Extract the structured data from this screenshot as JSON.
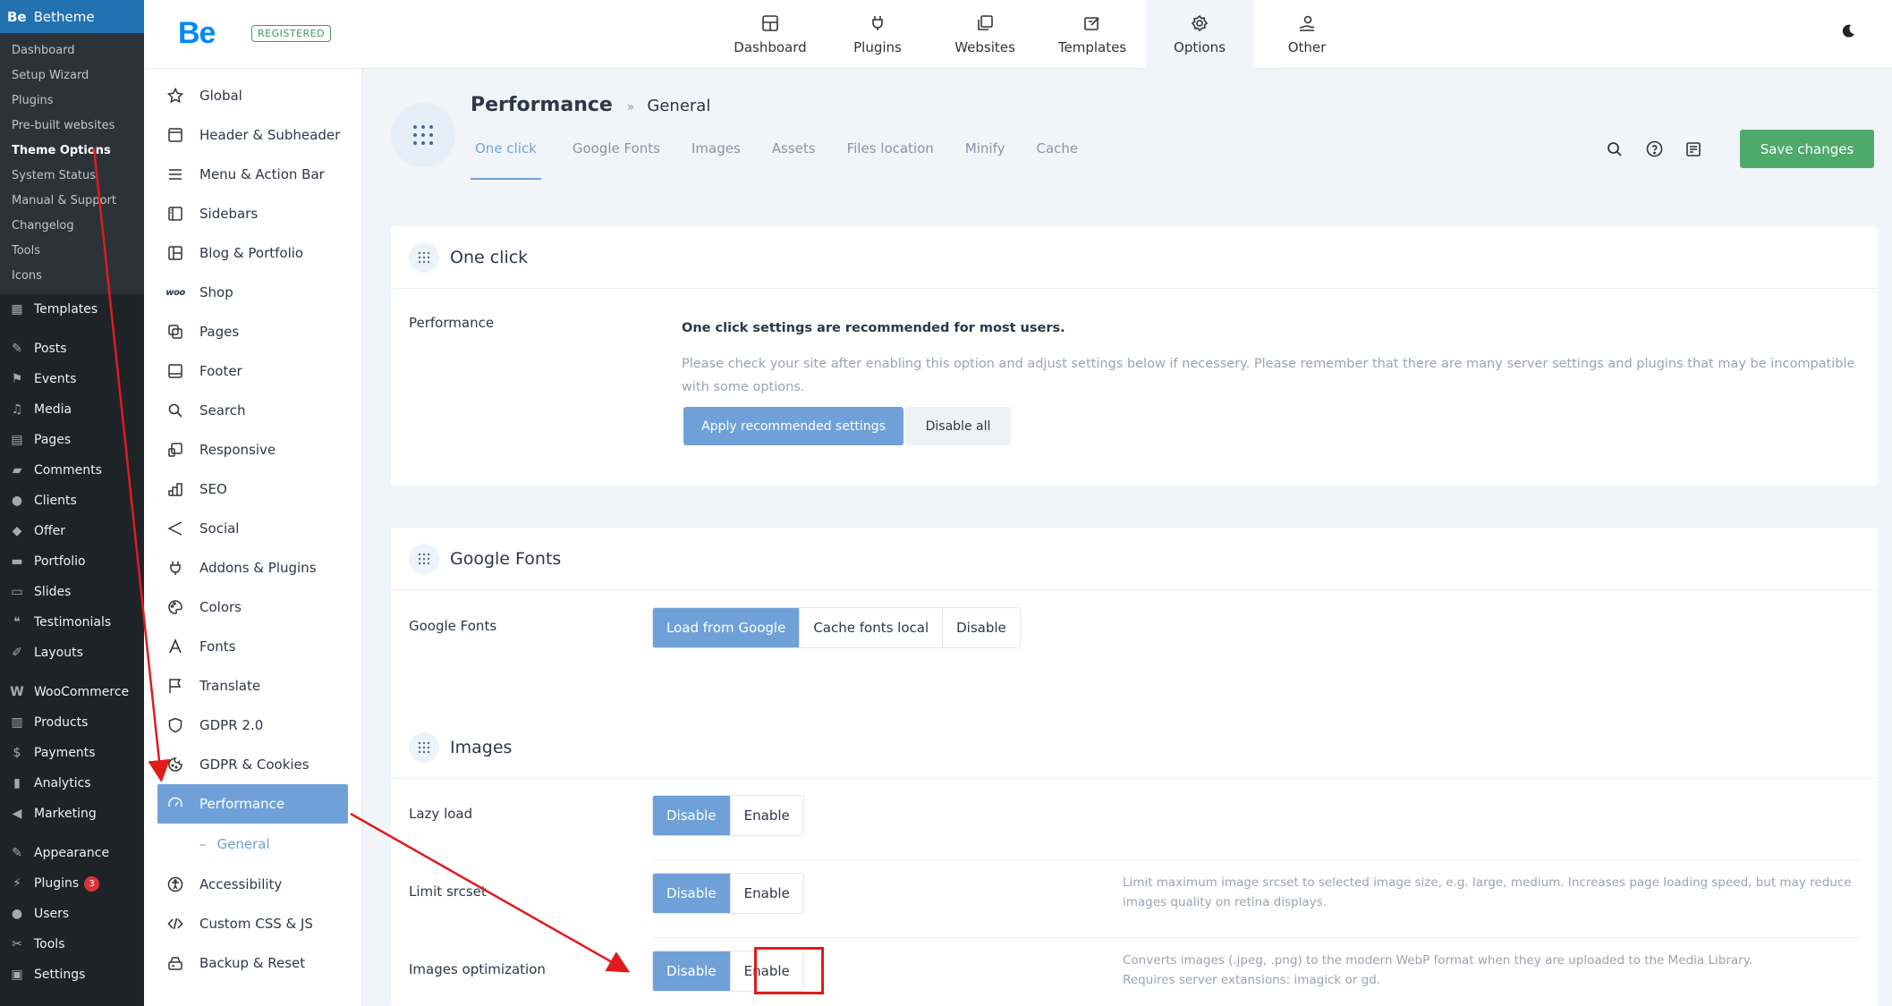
{
  "wp": {
    "brand": "Betheme",
    "brand_mark": "Be",
    "submenu": [
      "Dashboard",
      "Setup Wizard",
      "Plugins",
      "Pre-built websites",
      "Theme Options",
      "System Status",
      "Manual & Support",
      "Changelog",
      "Tools",
      "Icons"
    ],
    "menu": [
      {
        "label": "Templates",
        "icon": "grid-icon"
      },
      {
        "label": "Posts",
        "icon": "pin-icon"
      },
      {
        "label": "Events",
        "icon": "events-icon"
      },
      {
        "label": "Media",
        "icon": "media-icon"
      },
      {
        "label": "Pages",
        "icon": "pages-icon"
      },
      {
        "label": "Comments",
        "icon": "comment-icon"
      },
      {
        "label": "Clients",
        "icon": "user-icon"
      },
      {
        "label": "Offer",
        "icon": "tag-icon"
      },
      {
        "label": "Portfolio",
        "icon": "portfolio-icon"
      },
      {
        "label": "Slides",
        "icon": "slides-icon"
      },
      {
        "label": "Testimonials",
        "icon": "quote-icon"
      },
      {
        "label": "Layouts",
        "icon": "pen-icon"
      },
      {
        "label": "WooCommerce",
        "icon": "woo-icon"
      },
      {
        "label": "Products",
        "icon": "archive-icon"
      },
      {
        "label": "Payments",
        "icon": "payment-icon"
      },
      {
        "label": "Analytics",
        "icon": "chart-icon"
      },
      {
        "label": "Marketing",
        "icon": "megaphone-icon"
      },
      {
        "label": "Appearance",
        "icon": "brush-icon"
      },
      {
        "label": "Plugins",
        "icon": "plugin-icon",
        "badge": "3"
      },
      {
        "label": "Users",
        "icon": "users-icon"
      },
      {
        "label": "Tools",
        "icon": "wrench-icon"
      },
      {
        "label": "Settings",
        "icon": "settings-icon"
      }
    ]
  },
  "topbar": {
    "badge": "REGISTERED",
    "logo": "Be",
    "nav": [
      "Dashboard",
      "Plugins",
      "Websites",
      "Templates",
      "Options",
      "Other"
    ]
  },
  "options_menu": [
    "Global",
    "Header & Subheader",
    "Menu & Action Bar",
    "Sidebars",
    "Blog & Portfolio",
    "Shop",
    "Pages",
    "Footer",
    "Search",
    "Responsive",
    "SEO",
    "Social",
    "Addons & Plugins",
    "Colors",
    "Fonts",
    "Translate",
    "GDPR 2.0",
    "GDPR & Cookies",
    "Performance",
    "General",
    "Accessibility",
    "Custom CSS & JS",
    "Backup & Reset"
  ],
  "woo_mark": "woo",
  "header": {
    "title": "Performance",
    "separator": "»",
    "crumb": "General",
    "tabs": [
      "One click",
      "Google Fonts",
      "Images",
      "Assets",
      "Files location",
      "Minify",
      "Cache"
    ],
    "save": "Save changes"
  },
  "one_click": {
    "title": "One click",
    "label": "Performance",
    "heading": "One click settings are recommended for most users.",
    "text": "Please check your site after enabling this option and adjust settings below if necessery. Please remember that there are many server settings and plugins that may be incompatible with some options.",
    "apply": "Apply recommended settings",
    "disable_all": "Disable all"
  },
  "google_fonts": {
    "title": "Google Fonts",
    "label": "Google Fonts",
    "options": [
      "Load from Google",
      "Cache fonts local",
      "Disable"
    ]
  },
  "images": {
    "title": "Images",
    "lazy_label": "Lazy load",
    "srcset_label": "Limit srcset",
    "srcset_desc": "Limit maximum image srcset to selected image size, e.g. large, medium. Increases page loading speed, but may reduce images quality on retina displays.",
    "opt_label": "Images optimization",
    "opt_desc_1": "Converts images (.jpeg, .png) to the modern WebP format when they are uploaded to the Media Library.",
    "opt_desc_2": "Requires server extansions: imagick or gd.",
    "disable": "Disable",
    "enable": "Enable"
  },
  "colors": {
    "accent": "#6fa1d8",
    "save": "#4fa96b",
    "wp_dark": "#1d2327",
    "wp_blue": "#2271b1",
    "annotation": "#e01b1b"
  }
}
